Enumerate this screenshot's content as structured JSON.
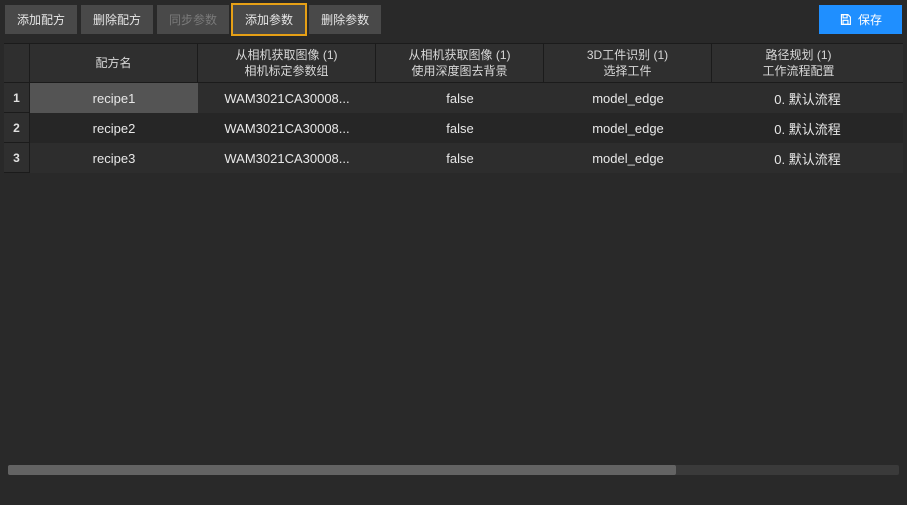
{
  "toolbar": {
    "add_recipe": "添加配方",
    "delete_recipe": "删除配方",
    "sync_params": "同步参数",
    "add_param": "添加参数",
    "delete_param": "删除参数",
    "save": "保存"
  },
  "columns": {
    "recipe_name": "配方名",
    "c1_line1": "从相机获取图像 (1)",
    "c1_line2": "相机标定参数组",
    "c2_line1": "从相机获取图像 (1)",
    "c2_line2": "使用深度图去背景",
    "c3_line1": "3D工件识别 (1)",
    "c3_line2": "选择工件",
    "c4_line1": "路径规划 (1)",
    "c4_line2": "工作流程配置"
  },
  "rows": [
    {
      "idx": "1",
      "name": "recipe1",
      "c1": "WAM3021CA30008...",
      "c2": "false",
      "c3": "model_edge",
      "c4": "0. 默认流程",
      "selected": true
    },
    {
      "idx": "2",
      "name": "recipe2",
      "c1": "WAM3021CA30008...",
      "c2": "false",
      "c3": "model_edge",
      "c4": "0. 默认流程",
      "selected": false
    },
    {
      "idx": "3",
      "name": "recipe3",
      "c1": "WAM3021CA30008...",
      "c2": "false",
      "c3": "model_edge",
      "c4": "0. 默认流程",
      "selected": false
    }
  ]
}
